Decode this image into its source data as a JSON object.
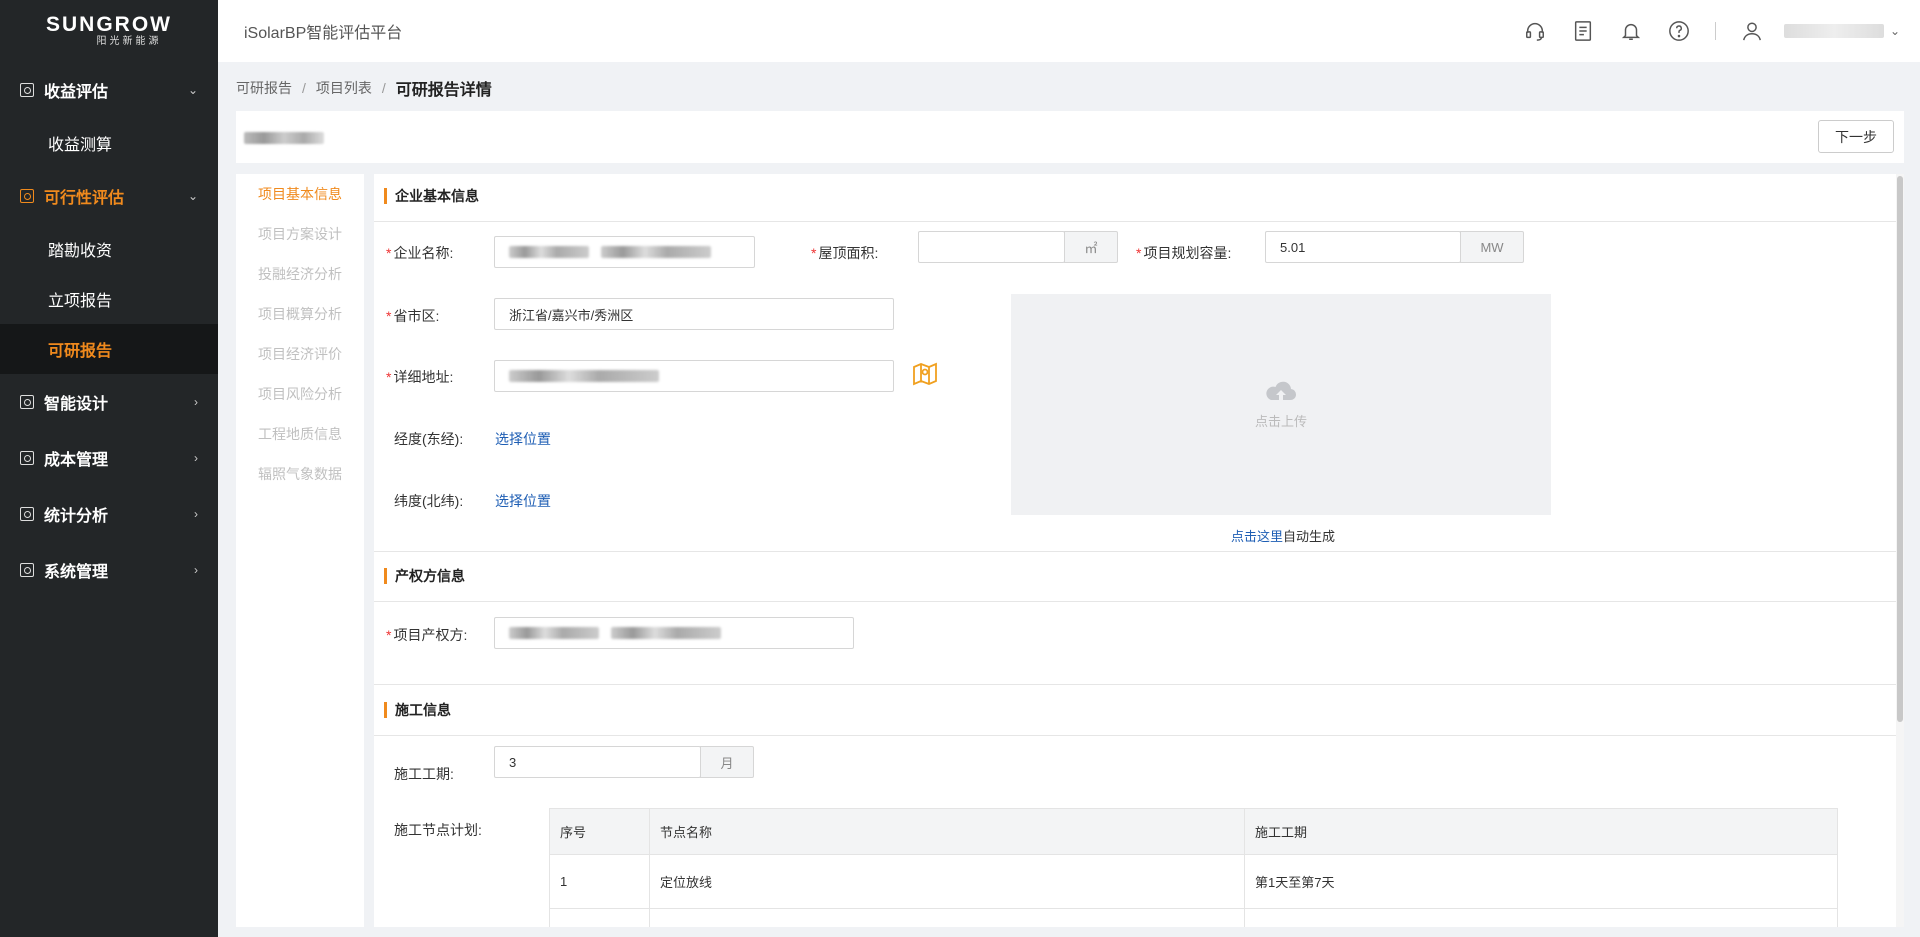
{
  "logo": {
    "main": "SUNGROW",
    "sub": "阳光新能源"
  },
  "sidebar": {
    "groups": [
      {
        "label": "收益评估",
        "expanded": true,
        "subs": [
          "收益测算"
        ]
      },
      {
        "label": "可行性评估",
        "expanded": true,
        "subs": [
          "踏勘收资",
          "立项报告",
          "可研报告"
        ]
      },
      {
        "label": "智能设计",
        "expanded": false
      },
      {
        "label": "成本管理",
        "expanded": false
      },
      {
        "label": "统计分析",
        "expanded": false
      },
      {
        "label": "系统管理",
        "expanded": false
      }
    ],
    "active_item": "可研报告"
  },
  "header": {
    "title": "iSolarBP智能评估平台",
    "icons": [
      "headset-icon",
      "document-icon",
      "bell-icon",
      "help-icon",
      "user-icon"
    ]
  },
  "breadcrumb": {
    "items": [
      "可研报告",
      "项目列表"
    ],
    "current": "可研报告详情"
  },
  "toolbar": {
    "next_label": "下一步"
  },
  "leftnav": {
    "items": [
      "项目基本信息",
      "项目方案设计",
      "投融经济分析",
      "项目概算分析",
      "项目经济评价",
      "项目风险分析",
      "工程地质信息",
      "辐照气象数据"
    ],
    "active_index": 0
  },
  "enterprise": {
    "title": "企业基本信息",
    "company_label": "企业名称:",
    "roof_label": "屋顶面积:",
    "roof_value": "",
    "roof_unit": "㎡",
    "capacity_label": "项目规划容量:",
    "capacity_value": "5.01",
    "capacity_unit": "MW",
    "region_label": "省市区:",
    "region_value": "浙江省/嘉兴市/秀洲区",
    "address_label": "详细地址:",
    "lng_label": "经度(东经):",
    "lng_link": "选择位置",
    "lat_label": "纬度(北纬):",
    "lat_link": "选择位置",
    "upload_text": "点击上传",
    "autogen_link": "点击这里",
    "autogen_text": "自动生成"
  },
  "owner": {
    "title": "产权方信息",
    "owner_label": "项目产权方:"
  },
  "construction": {
    "title": "施工信息",
    "period_label": "施工工期:",
    "period_value": "3",
    "period_unit": "月",
    "plan_label": "施工节点计划:",
    "table_headers": [
      "序号",
      "节点名称",
      "施工工期"
    ],
    "rows": [
      [
        "1",
        "定位放线",
        "第1天至第7天"
      ]
    ]
  }
}
